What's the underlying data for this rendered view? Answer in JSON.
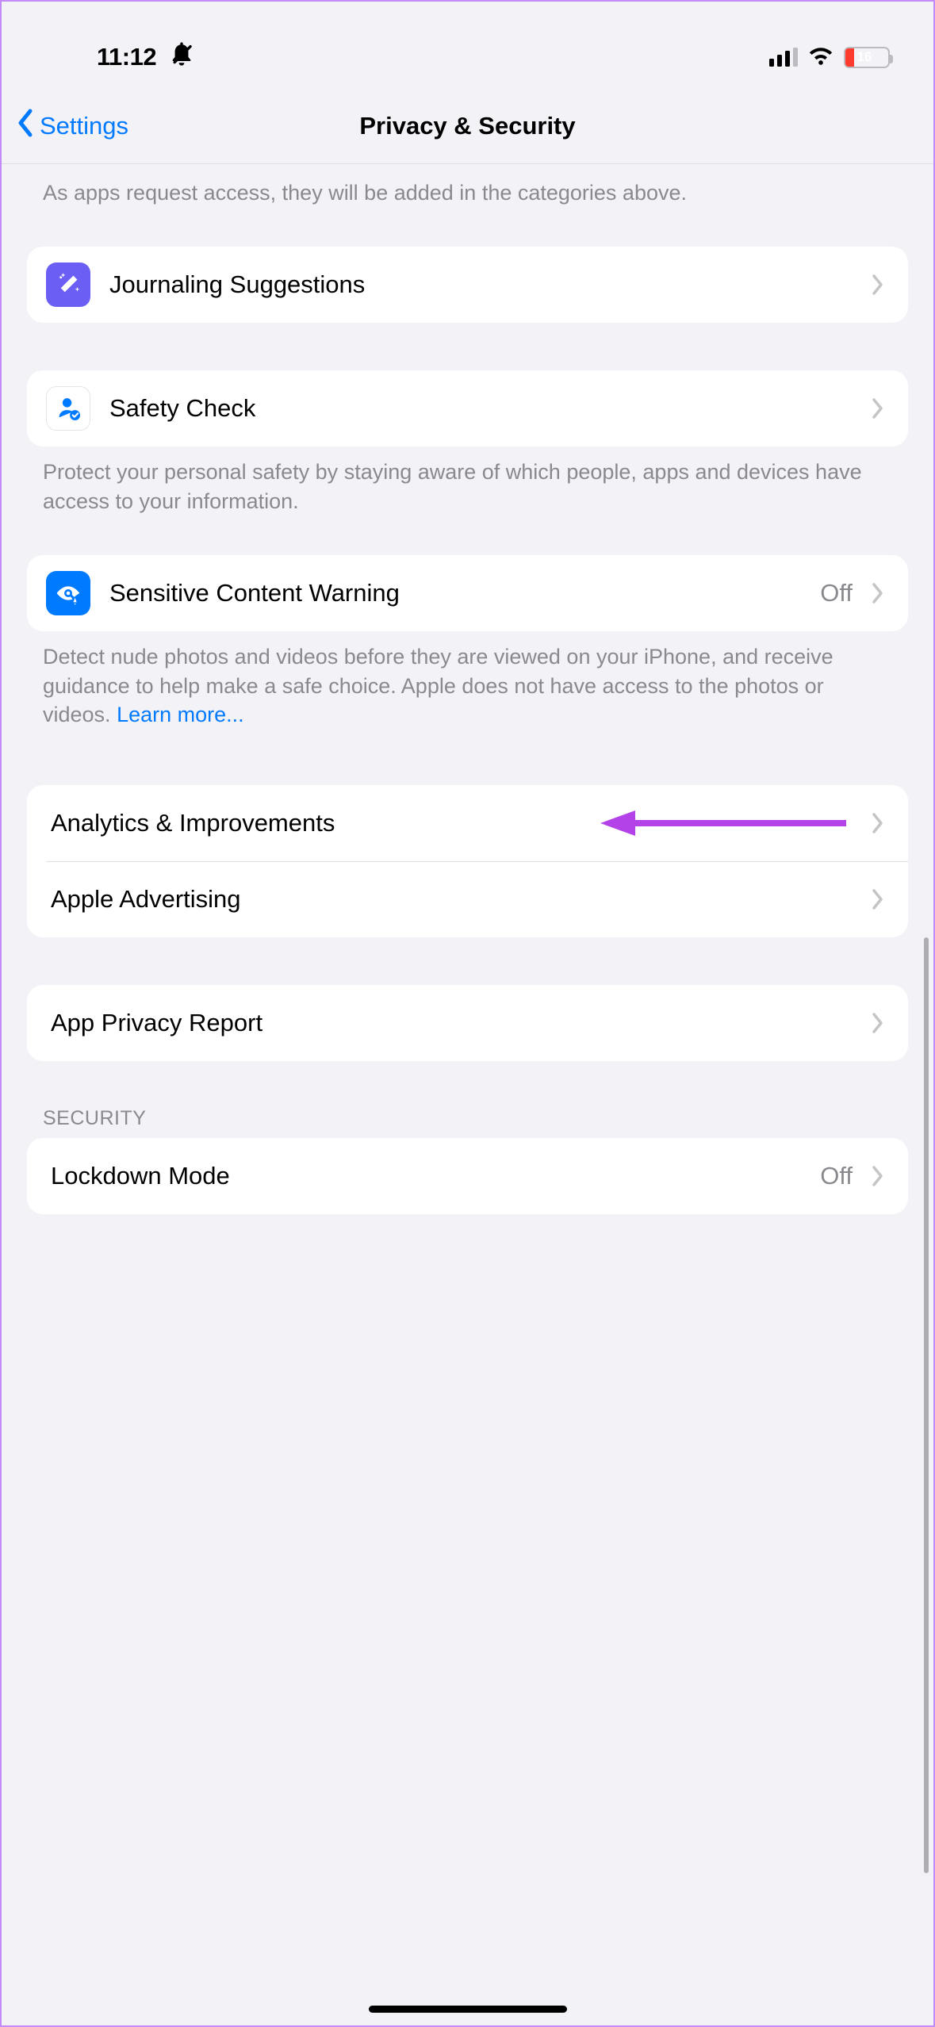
{
  "status": {
    "time": "11:12",
    "battery_pct": "16"
  },
  "nav": {
    "back_label": "Settings",
    "title": "Privacy & Security"
  },
  "intro_footer": "As apps request access, they will be added in the categories above.",
  "journaling": {
    "label": "Journaling Suggestions"
  },
  "safety_check": {
    "label": "Safety Check",
    "footer": "Protect your personal safety by staying aware of which people, apps and devices have access to your information."
  },
  "sensitive": {
    "label": "Sensitive Content Warning",
    "value": "Off",
    "footer_text": "Detect nude photos and videos before they are viewed on your iPhone, and receive guidance to help make a safe choice. Apple does not have access to the photos or videos. ",
    "learn_more": "Learn more..."
  },
  "analytics": {
    "label": "Analytics & Improvements"
  },
  "advertising": {
    "label": "Apple Advertising"
  },
  "app_privacy": {
    "label": "App Privacy Report"
  },
  "security_header": "SECURITY",
  "lockdown": {
    "label": "Lockdown Mode",
    "value": "Off"
  },
  "annotation": {
    "color": "#b442e9"
  }
}
